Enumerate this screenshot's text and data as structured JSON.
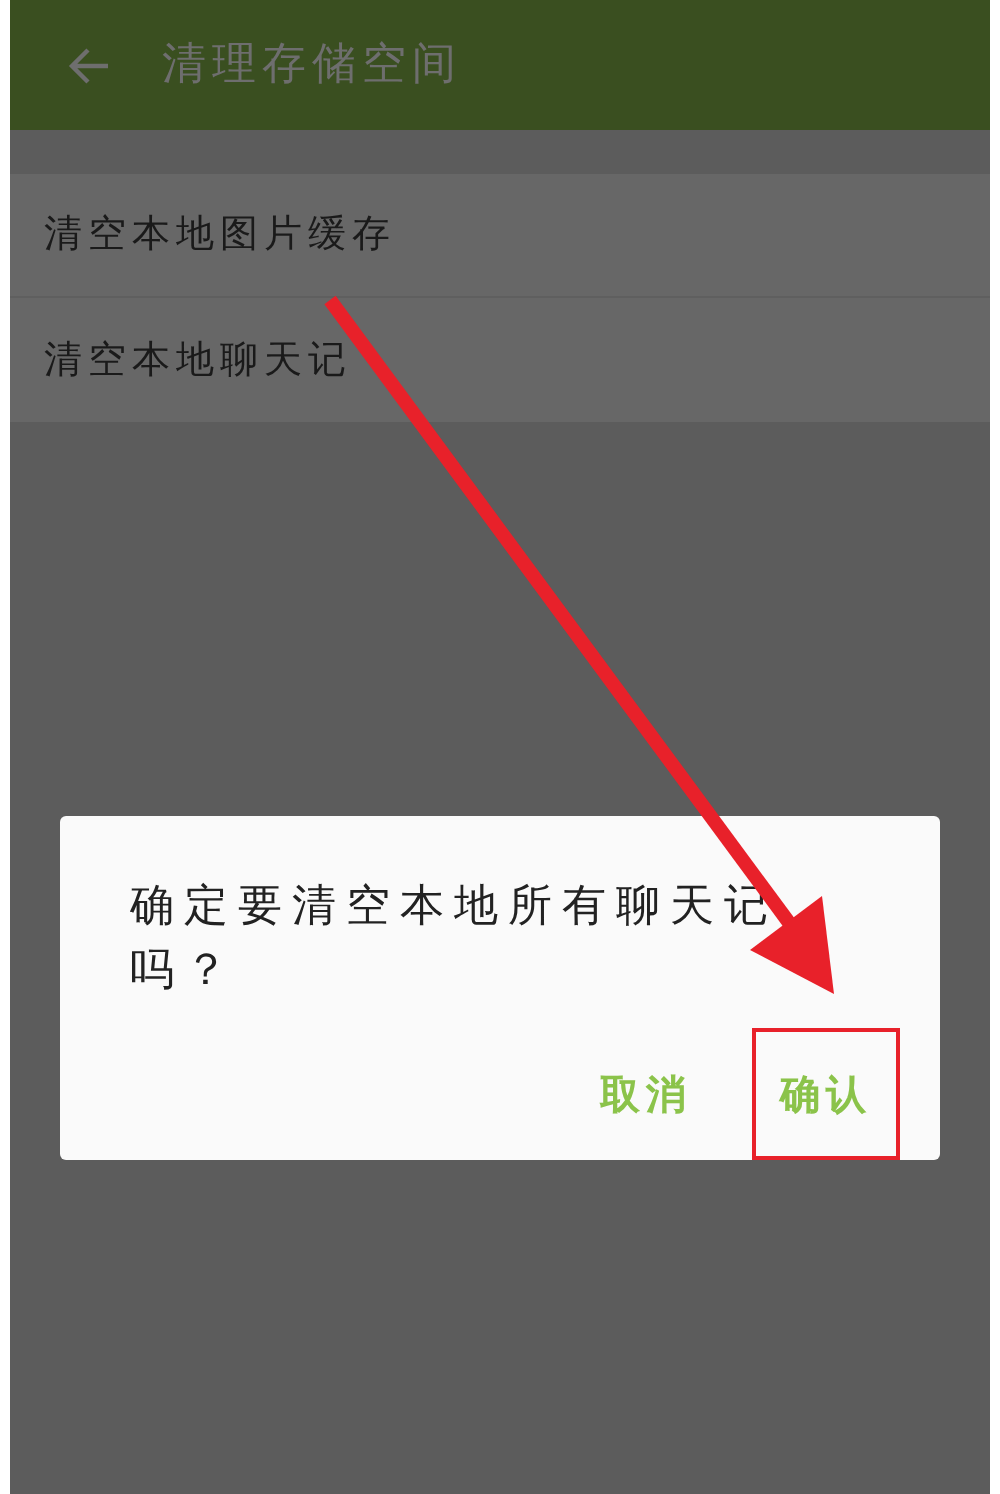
{
  "toolbar": {
    "title": "清理存储空间"
  },
  "items": [
    {
      "label": "清空本地图片缓存"
    },
    {
      "label": "清空本地聊天记"
    }
  ],
  "dialog": {
    "message_lines": [
      "确定要清空本地所有聊天记",
      "吗？"
    ],
    "buttons": [
      {
        "label": "取消",
        "highlighted": false
      },
      {
        "label": "确认",
        "highlighted": true
      }
    ]
  }
}
